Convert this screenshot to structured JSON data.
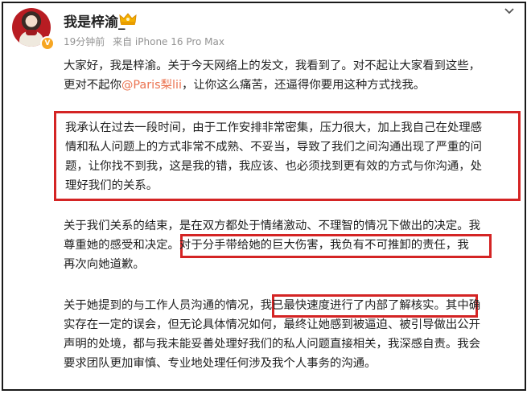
{
  "post": {
    "username": "我是梓渝_",
    "time": "19分钟前",
    "source": "来自 iPhone 16 Pro Max",
    "avatar_badge": "V",
    "p1": {
      "l1": "大家好，我是梓渝。关于今天网络上的发文，我看到了。对不起让大家看到这些，",
      "l2_pre": "更对不起你",
      "mention": "@Paris梨lii",
      "l2_post": "，让你这么痛苦，还逼得你要用这种方式找我。"
    },
    "p2": {
      "l1": "我承认在过去一段时间，由于工作安排非常密集，压力很大，加上我自己在处理感",
      "l2": "情和私人问题上的方式非常不成熟、不妥当，导致了我们之间沟通出现了严重的问",
      "l3": "题，让你找不到我，这是我的错，我应该、也必须找到更有效的方式与你沟通，处",
      "l4": "理好我们的关系。"
    },
    "p3": {
      "l1": "关于我们关系的结束，是在双方都处于情绪激动、不理智的情况下做出的决定。我",
      "l2_pre": "尊重她的感受和决定。",
      "l2_mark": "对于分手带给她的巨大伤害，我负有不可推卸的责任",
      "l2_post": "，我",
      "l3": "再次向她道歉。"
    },
    "p4": {
      "l1_pre": "关于她提到的与工作人员沟通的情况，",
      "l1_mark": "我已最快速度进行了内部了解核实。",
      "l1_post": "其中确",
      "l2": "实存在一定的误会，但无论具体情况如何，最终让她感到被逼迫、被引导做出公开",
      "l3": "声明的处境，都与我未能妥善处理好我们的私人问题直接相关，我深感自责。我会",
      "l4": "要求团队更加审慎、专业地处理任何涉及我个人事务的沟通。"
    }
  },
  "colors": {
    "mention": "#eb7350",
    "highlight_box": "#d42424",
    "meta_text": "#939393"
  },
  "icons": {
    "vip": "vip-crown-icon",
    "more": "chevron-down-icon",
    "verified": "verified-badge-icon"
  }
}
